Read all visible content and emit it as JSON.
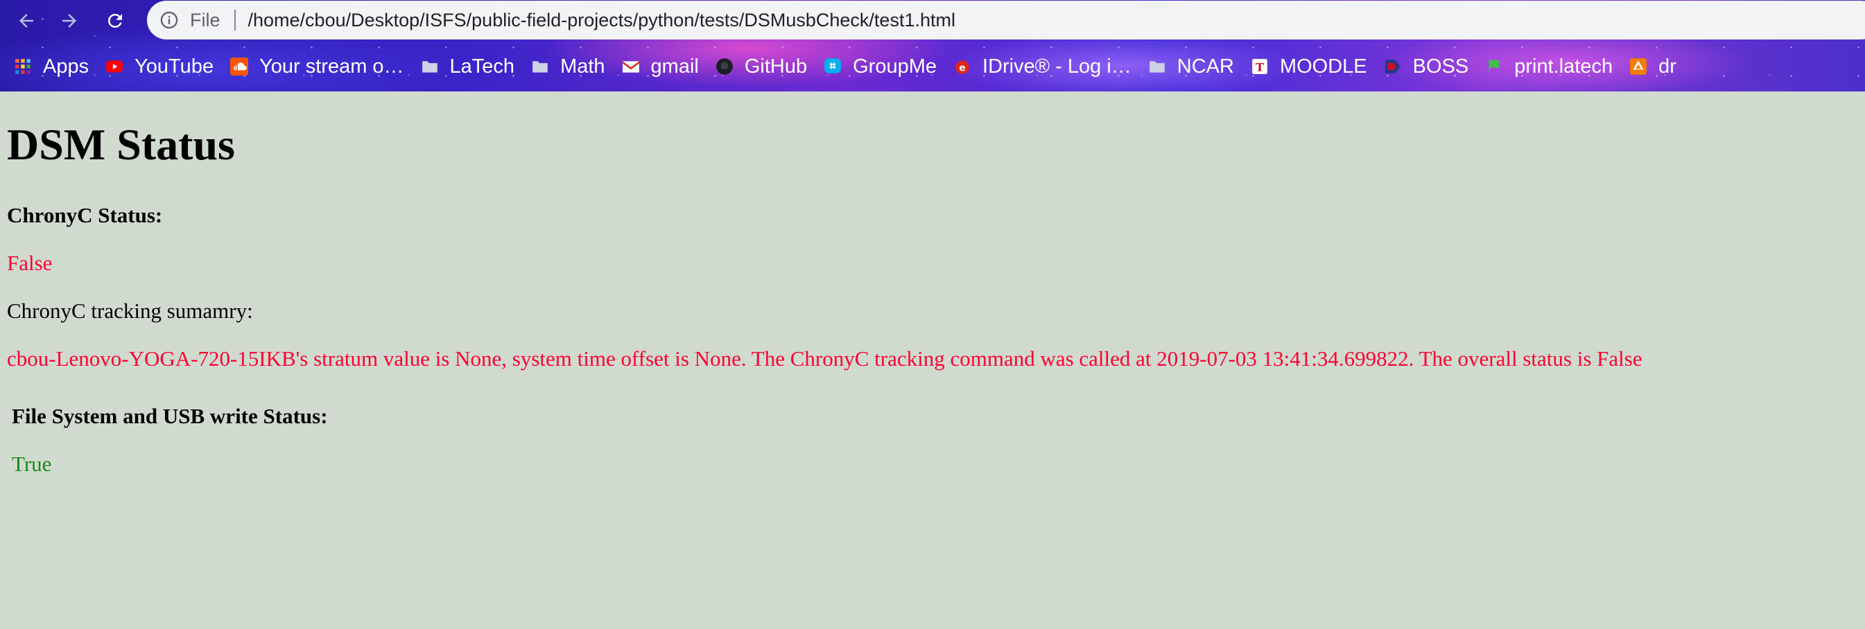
{
  "browser": {
    "omnibox": {
      "scheme_label": "File",
      "url": "/home/cbou/Desktop/ISFS/public-field-projects/python/tests/DSMusbCheck/test1.html"
    },
    "bookmarks": [
      {
        "label": "Apps",
        "icon": "apps-grid-icon"
      },
      {
        "label": "YouTube",
        "icon": "youtube-icon"
      },
      {
        "label": "Your stream o…",
        "icon": "soundcloud-icon"
      },
      {
        "label": "LaTech",
        "icon": "folder-icon"
      },
      {
        "label": "Math",
        "icon": "folder-icon"
      },
      {
        "label": "gmail",
        "icon": "gmail-icon"
      },
      {
        "label": "GitHub",
        "icon": "github-icon"
      },
      {
        "label": "GroupMe",
        "icon": "groupme-icon"
      },
      {
        "label": "IDrive® - Log i…",
        "icon": "idrive-icon"
      },
      {
        "label": "NCAR",
        "icon": "folder-icon"
      },
      {
        "label": "MOODLE",
        "icon": "moodle-icon"
      },
      {
        "label": "BOSS",
        "icon": "boss-icon"
      },
      {
        "label": "print.latech",
        "icon": "print-latech-icon"
      },
      {
        "label": "dr",
        "icon": "drive-icon"
      }
    ]
  },
  "page": {
    "title": "DSM Status",
    "chrony_heading": "ChronyC Status:",
    "chrony_status": "False",
    "tracking_heading": "ChronyC tracking sumamry:",
    "tracking_summary": "cbou-Lenovo-YOGA-720-15IKB's stratum value is None, system time offset is None. The ChronyC tracking command was called at 2019-07-03 13:41:34.699822. The overall status is False",
    "usb_heading": "File System and USB write Status:",
    "usb_status": "True"
  },
  "colors": {
    "page_background": "#d0dace",
    "status_false": "#ff0033",
    "status_true": "#1a8a1a"
  }
}
